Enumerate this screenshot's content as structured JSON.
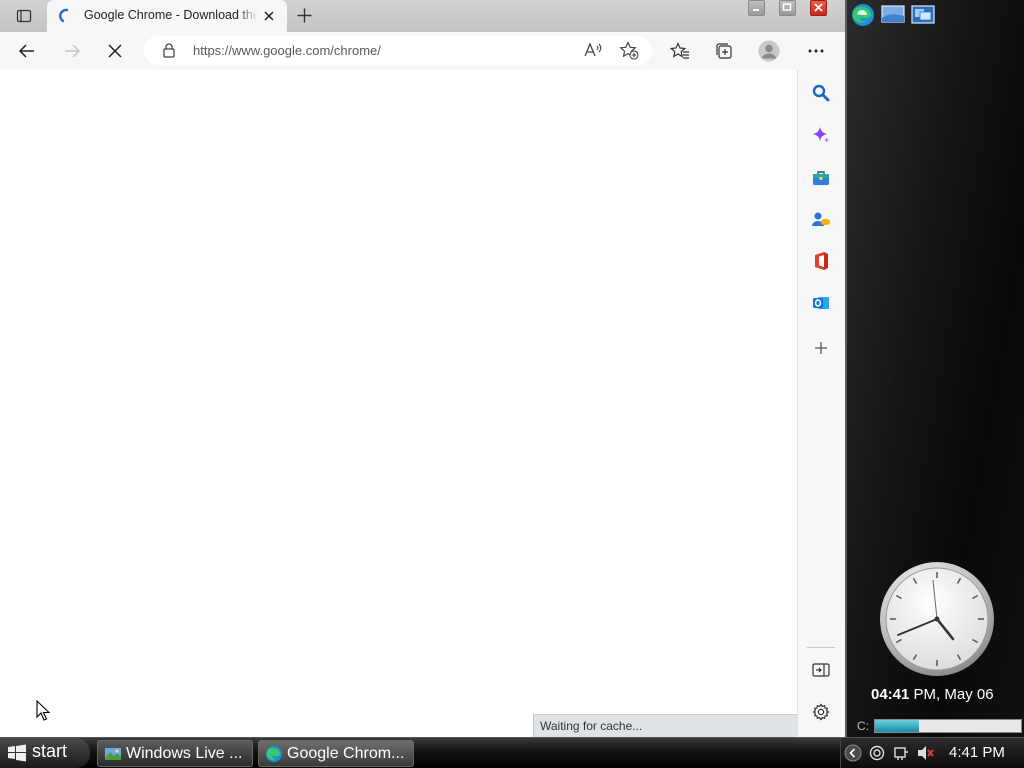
{
  "browser": {
    "tab": {
      "title": "Google Chrome - Download the fast, secure browser"
    },
    "address_bar": {
      "url": "https://www.google.com/chrome/"
    },
    "status_text": "Waiting for cache..."
  },
  "desktop_gadgets": {
    "clock": {
      "time": "04:41",
      "suffix": " PM, May 06"
    },
    "drive": {
      "label": "C:",
      "usage_fraction": 0.3
    }
  },
  "taskbar": {
    "start_label": "start",
    "tasks": [
      {
        "label": "Windows Live ..."
      },
      {
        "label": "Google Chrom..."
      }
    ],
    "tray_time": "4:41 PM"
  },
  "colors": {
    "edge_blue": "#1a73e8",
    "copilot_purple": "#8a3ffc",
    "office_red": "#e43e2b",
    "outlook_blue": "#0f78d4",
    "close_red": "#e81123"
  }
}
